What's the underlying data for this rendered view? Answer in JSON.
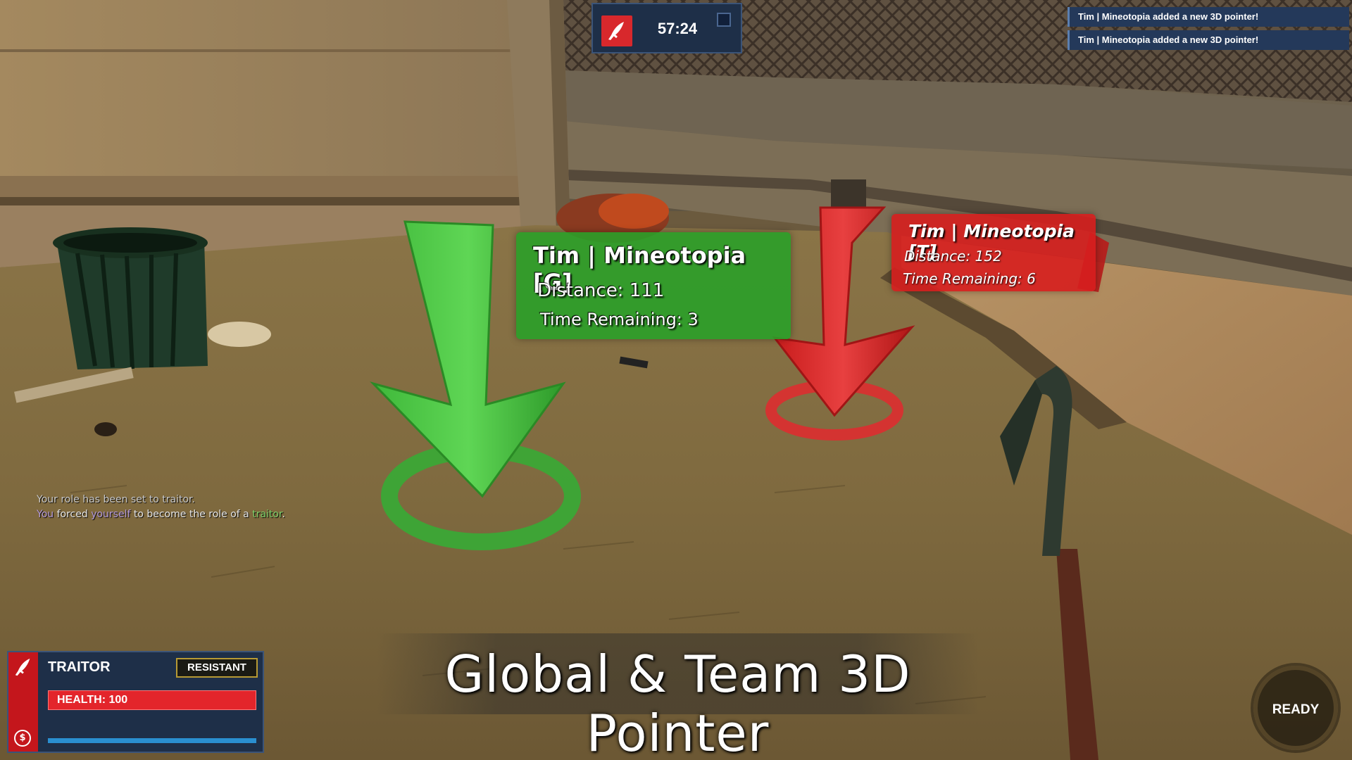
{
  "round": {
    "timer": "57:24",
    "role_icon": "traitor-knife-icon",
    "accent": "#d8282c"
  },
  "notifications": [
    "Tim | Mineotopia added a new 3D pointer!",
    "Tim | Mineotopia added a new 3D pointer!"
  ],
  "pointers": {
    "global": {
      "name": "Tim | Mineotopia [G]",
      "distance": "Distance: 111",
      "time_remaining": "Time Remaining: 3",
      "color": "#2ea82e",
      "icon": "green-down-arrow-icon"
    },
    "team": {
      "name": "Tim | Mineotopia [T]",
      "distance": "Distance: 152",
      "time_remaining": "Time Remaining: 6",
      "color": "#d61e1e",
      "icon": "red-down-arrow-icon"
    }
  },
  "chat": {
    "line1": "Your role has been set to traitor.",
    "line2_a": "You",
    "line2_b": " forced ",
    "line2_c": "yourself",
    "line2_d": " to become the role of a ",
    "line2_e": "traitor",
    "line2_f": "."
  },
  "title": "Global & Team 3D Pointer",
  "hud": {
    "role": "TRAITOR",
    "badge": "RESISTANT",
    "health": "HEALTH: 100",
    "health_fraction": 1.0,
    "credit_fraction": 1.0,
    "credits_icon": "dollar-coin-icon"
  },
  "ready": "READY"
}
